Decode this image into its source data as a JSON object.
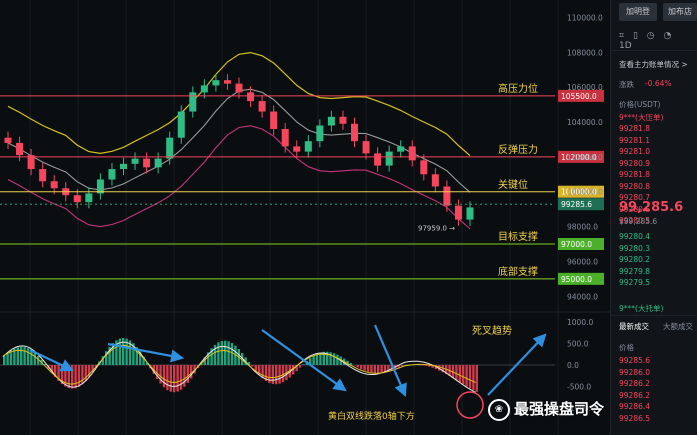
{
  "price_axis": [
    "110000.0",
    "108000.0",
    "106000.0",
    "104000.0",
    "102000.0",
    "100000.0",
    "98000.0",
    "96000.0",
    "94000.0"
  ],
  "indicator_axis": [
    "1000.0",
    "500.0",
    "0.0",
    "-500.0",
    "-1000.0"
  ],
  "levels": [
    {
      "price": 105500,
      "tag": "105500.0",
      "label": "高压力位",
      "color": "#f6465d"
    },
    {
      "price": 102000,
      "tag": "102000.0",
      "label": "反弹压力",
      "color": "#f6465d"
    },
    {
      "price": 100000,
      "tag": "100000.0",
      "label": "关键位",
      "color": "#f0d14a"
    },
    {
      "price": 97000,
      "tag": "97000.0",
      "label": "目标支撑",
      "color": "#7ed321"
    },
    {
      "price": 95000,
      "tag": "95000.0",
      "label": "底部支撑",
      "color": "#7ed321"
    }
  ],
  "current_price_tag": "99285.6",
  "low_marker": "97959.0",
  "annotations": {
    "dead_cross": "死叉趋势",
    "below_zero": "黄白双线跌落0轴下方"
  },
  "watermark": "最强操盘司令",
  "panel": {
    "buttons": [
      "加明登",
      "加布店"
    ],
    "tools": [
      "⌗",
      "▯",
      "◷",
      "◔",
      "1D"
    ],
    "main_force": "查看主力账单情况 >",
    "change_label": "涨跌",
    "change_value": "-0.64%",
    "price_header": "价格(USDT)",
    "ask_tag": "9***(大压单)",
    "asks": [
      "99281.8",
      "99281.1",
      "99281.0",
      "99280.9",
      "99281.8",
      "99280.8",
      "99280.7",
      "99280.6",
      "99280.5"
    ],
    "last_price": "99,285.6",
    "last_price_sub": "$99,285.6",
    "bids": [
      "99280.4",
      "99280.3",
      "99280.2",
      "99279.8",
      "99279.5"
    ],
    "bid_tag": "9***(大托单)",
    "trades_tab": "最新成交",
    "trades_tab2": "大额成交",
    "trades_header": "价格",
    "trades": [
      "99285.6",
      "99286.0",
      "99286.2",
      "99286.2",
      "99286.4",
      "99286.5"
    ]
  },
  "chart_data": {
    "type": "line",
    "title": "",
    "series": [
      {
        "values": [
          102800,
          102100,
          101300,
          100600,
          100200,
          99800,
          99400,
          99900,
          100700,
          101300,
          101600,
          101900,
          101400,
          101900,
          103100,
          104600,
          105700,
          106100,
          106400,
          106200,
          105700,
          105200,
          104600,
          103600,
          102600,
          102300,
          102900,
          103800,
          104300,
          103900,
          102900,
          102200,
          101500,
          102300,
          102600,
          101800,
          101000,
          100300,
          99200,
          98400,
          99100
        ]
      }
    ],
    "bollinger": {
      "upper": true,
      "middle": true,
      "lower": true
    },
    "ylim": [
      93500,
      111000
    ],
    "macd": {
      "zero_line": true
    }
  }
}
